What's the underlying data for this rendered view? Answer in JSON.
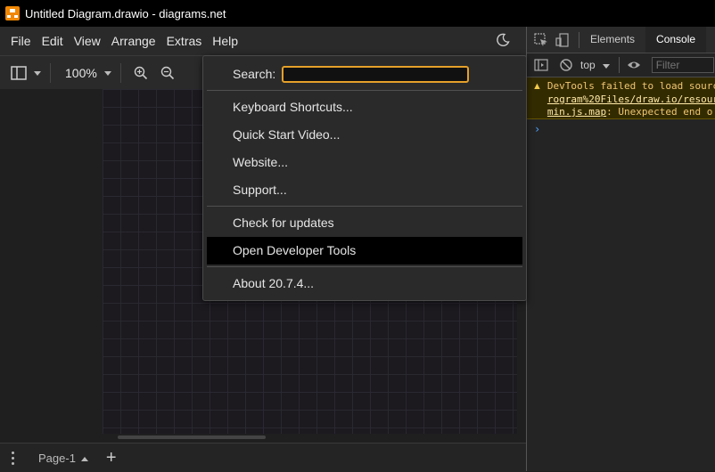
{
  "window": {
    "title": "Untitled Diagram.drawio - diagrams.net"
  },
  "menubar": {
    "items": [
      "File",
      "Edit",
      "View",
      "Arrange",
      "Extras",
      "Help"
    ]
  },
  "toolbar": {
    "zoom": "100%"
  },
  "bottombar": {
    "page_tab": "Page-1"
  },
  "help_menu": {
    "search_label": "Search:",
    "search_value": "",
    "items": [
      "Keyboard Shortcuts...",
      "Quick Start Video...",
      "Website...",
      "Support...",
      "Check for updates",
      "Open Developer Tools",
      "About 20.7.4..."
    ],
    "highlighted": "Open Developer Tools"
  },
  "devtools": {
    "tabs": [
      "Elements",
      "Console"
    ],
    "active_tab": "Console",
    "context": "top",
    "filter_placeholder": "Filter",
    "console": {
      "warning_line1": "DevTools failed to load sourc",
      "warning_link1": "rogram%20Files/draw.io/resour",
      "warning_link2": "min.js.map",
      "warning_rest": ": Unexpected end o",
      "prompt": "›"
    }
  },
  "colors": {
    "accent_orange": "#f08705",
    "search_border": "#e5a02a",
    "console_warning_text": "#f0c674",
    "console_prompt": "#4da3ff"
  }
}
